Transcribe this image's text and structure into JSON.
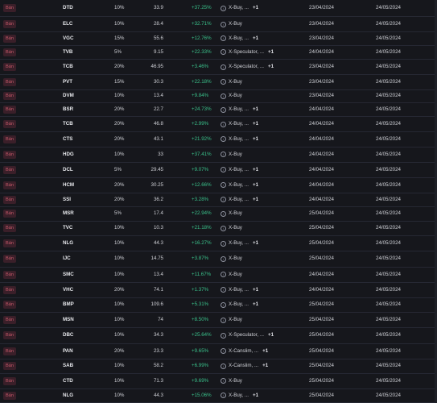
{
  "rows": [
    {
      "side": "Bán",
      "ticker": "DTD",
      "pct": "10%",
      "price": "33.9",
      "change": "+37.25%",
      "strategy": "X-Buy, ...",
      "more": "+1",
      "start": "23/04/2024",
      "end": "24/05/2024"
    },
    {
      "side": "Bán",
      "ticker": "ELC",
      "pct": "10%",
      "price": "28.4",
      "change": "+32.71%",
      "strategy": "X-Buy",
      "more": "",
      "start": "23/04/2024",
      "end": "24/05/2024"
    },
    {
      "side": "Bán",
      "ticker": "VGC",
      "pct": "15%",
      "price": "55.6",
      "change": "+12.76%",
      "strategy": "X-Buy, ...",
      "more": "+1",
      "start": "23/04/2024",
      "end": "24/05/2024"
    },
    {
      "side": "Bán",
      "ticker": "TVB",
      "pct": "5%",
      "price": "9.15",
      "change": "+22.33%",
      "strategy": "X-Speculator, ...",
      "more": "+1",
      "start": "24/04/2024",
      "end": "24/05/2024"
    },
    {
      "side": "Bán",
      "ticker": "TCB",
      "pct": "20%",
      "price": "46.95",
      "change": "+3.46%",
      "strategy": "X-Speculator, ...",
      "more": "+1",
      "start": "23/04/2024",
      "end": "24/05/2024"
    },
    {
      "side": "Bán",
      "ticker": "PVT",
      "pct": "15%",
      "price": "30.3",
      "change": "+22.18%",
      "strategy": "X-Buy",
      "more": "",
      "start": "23/04/2024",
      "end": "24/05/2024"
    },
    {
      "side": "Bán",
      "ticker": "DVM",
      "pct": "10%",
      "price": "13.4",
      "change": "+9.84%",
      "strategy": "X-Buy",
      "more": "",
      "start": "23/04/2024",
      "end": "24/05/2024"
    },
    {
      "side": "Bán",
      "ticker": "BSR",
      "pct": "20%",
      "price": "22.7",
      "change": "+24.73%",
      "strategy": "X-Buy, ...",
      "more": "+1",
      "start": "24/04/2024",
      "end": "24/05/2024"
    },
    {
      "side": "Bán",
      "ticker": "TCB",
      "pct": "20%",
      "price": "46.8",
      "change": "+2.99%",
      "strategy": "X-Buy, ...",
      "more": "+1",
      "start": "24/04/2024",
      "end": "24/05/2024"
    },
    {
      "side": "Bán",
      "ticker": "CTS",
      "pct": "20%",
      "price": "43.1",
      "change": "+21.92%",
      "strategy": "X-Buy, ...",
      "more": "+1",
      "start": "24/04/2024",
      "end": "24/05/2024"
    },
    {
      "side": "Bán",
      "ticker": "HDG",
      "pct": "10%",
      "price": "33",
      "change": "+37.41%",
      "strategy": "X-Buy",
      "more": "",
      "start": "24/04/2024",
      "end": "24/05/2024"
    },
    {
      "side": "Bán",
      "ticker": "DCL",
      "pct": "5%",
      "price": "29.45",
      "change": "+9.07%",
      "strategy": "X-Buy, ...",
      "more": "+1",
      "start": "24/04/2024",
      "end": "24/05/2024"
    },
    {
      "side": "Bán",
      "ticker": "HCM",
      "pct": "20%",
      "price": "30.25",
      "change": "+12.66%",
      "strategy": "X-Buy, ...",
      "more": "+1",
      "start": "24/04/2024",
      "end": "24/05/2024"
    },
    {
      "side": "Bán",
      "ticker": "SSI",
      "pct": "20%",
      "price": "36.2",
      "change": "+3.28%",
      "strategy": "X-Buy, ...",
      "more": "+1",
      "start": "24/04/2024",
      "end": "24/05/2024"
    },
    {
      "side": "Bán",
      "ticker": "MSR",
      "pct": "5%",
      "price": "17.4",
      "change": "+22.94%",
      "strategy": "X-Buy",
      "more": "",
      "start": "25/04/2024",
      "end": "24/05/2024"
    },
    {
      "side": "Bán",
      "ticker": "TVC",
      "pct": "10%",
      "price": "10.3",
      "change": "+21.18%",
      "strategy": "X-Buy",
      "more": "",
      "start": "25/04/2024",
      "end": "24/05/2024"
    },
    {
      "side": "Bán",
      "ticker": "NLG",
      "pct": "10%",
      "price": "44.3",
      "change": "+16.27%",
      "strategy": "X-Buy, ...",
      "more": "+1",
      "start": "25/04/2024",
      "end": "24/05/2024"
    },
    {
      "side": "Bán",
      "ticker": "IJC",
      "pct": "10%",
      "price": "14.75",
      "change": "+3.87%",
      "strategy": "X-Buy",
      "more": "",
      "start": "25/04/2024",
      "end": "24/05/2024"
    },
    {
      "side": "Bán",
      "ticker": "SMC",
      "pct": "10%",
      "price": "13.4",
      "change": "+11.67%",
      "strategy": "X-Buy",
      "more": "",
      "start": "24/04/2024",
      "end": "24/05/2024"
    },
    {
      "side": "Bán",
      "ticker": "VHC",
      "pct": "20%",
      "price": "74.1",
      "change": "+1.37%",
      "strategy": "X-Buy, ...",
      "more": "+1",
      "start": "24/04/2024",
      "end": "24/05/2024"
    },
    {
      "side": "Bán",
      "ticker": "BMP",
      "pct": "10%",
      "price": "109.6",
      "change": "+5.31%",
      "strategy": "X-Buy, ...",
      "more": "+1",
      "start": "25/04/2024",
      "end": "24/05/2024"
    },
    {
      "side": "Bán",
      "ticker": "MSN",
      "pct": "10%",
      "price": "74",
      "change": "+8.50%",
      "strategy": "X-Buy",
      "more": "",
      "start": "25/04/2024",
      "end": "24/05/2024"
    },
    {
      "side": "Bán",
      "ticker": "DBC",
      "pct": "10%",
      "price": "34.3",
      "change": "+25.64%",
      "strategy": "X-Speculator, ...",
      "more": "+1",
      "start": "25/04/2024",
      "end": "24/05/2024"
    },
    {
      "side": "Bán",
      "ticker": "PAN",
      "pct": "20%",
      "price": "23.3",
      "change": "+9.65%",
      "strategy": "X-Canslim, ...",
      "more": "+1",
      "start": "25/04/2024",
      "end": "24/05/2024"
    },
    {
      "side": "Bán",
      "ticker": "SAB",
      "pct": "10%",
      "price": "58.2",
      "change": "+6.99%",
      "strategy": "X-Canslim, ...",
      "more": "+1",
      "start": "25/04/2024",
      "end": "24/05/2024"
    },
    {
      "side": "Bán",
      "ticker": "CTD",
      "pct": "10%",
      "price": "71.3",
      "change": "+9.69%",
      "strategy": "X-Buy",
      "more": "",
      "start": "25/04/2024",
      "end": "24/05/2024"
    },
    {
      "side": "Bán",
      "ticker": "NLG",
      "pct": "10%",
      "price": "44.3",
      "change": "+15.06%",
      "strategy": "X-Buy, ...",
      "more": "+1",
      "start": "25/04/2024",
      "end": "24/05/2024"
    }
  ]
}
